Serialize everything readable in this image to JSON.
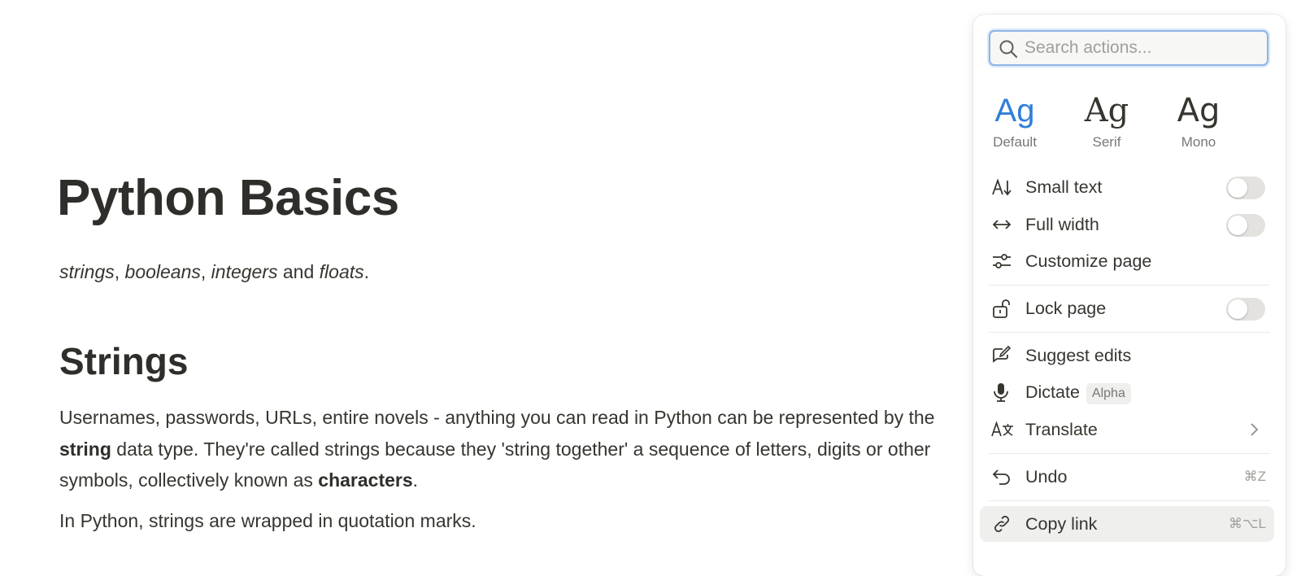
{
  "document": {
    "title": "Python Basics",
    "subtitle": {
      "items": [
        "strings",
        "booleans",
        "integers",
        "floats"
      ],
      "sep1": ", ",
      "sep2": ", ",
      "conj": " and ",
      "end": "."
    },
    "heading": "Strings",
    "paragraph1": {
      "part1": "Usernames, passwords, URLs, entire novels - anything you can read in Python can be represented by the ",
      "bold1": "string",
      "part2": " data type. They're called strings because they 'string together' a sequence of letters, digits or other symbols, collectively known as ",
      "bold2": "characters",
      "part3": "."
    },
    "paragraph2": "In Python, strings are wrapped in quotation marks."
  },
  "menu": {
    "search_placeholder": "Search actions...",
    "font_options": [
      {
        "glyph": "Ag",
        "label": "Default",
        "selected": true
      },
      {
        "glyph": "Ag",
        "label": "Serif",
        "selected": false
      },
      {
        "glyph": "Ag",
        "label": "Mono",
        "selected": false
      }
    ],
    "items": {
      "small_text": {
        "label": "Small text",
        "icon": "small-text-icon",
        "toggle": false
      },
      "full_width": {
        "label": "Full width",
        "icon": "full-width-icon",
        "toggle": false
      },
      "customize_page": {
        "label": "Customize page",
        "icon": "sliders-icon"
      },
      "lock_page": {
        "label": "Lock page",
        "icon": "lock-icon",
        "toggle": false
      },
      "suggest_edits": {
        "label": "Suggest edits",
        "icon": "suggest-edit-icon"
      },
      "dictate": {
        "label": "Dictate",
        "badge": "Alpha",
        "icon": "microphone-icon"
      },
      "translate": {
        "label": "Translate",
        "icon": "translate-icon"
      },
      "undo": {
        "label": "Undo",
        "shortcut": "⌘Z",
        "icon": "undo-icon"
      },
      "copy_link": {
        "label": "Copy link",
        "shortcut": "⌘⌥L",
        "icon": "link-icon"
      }
    }
  },
  "colors": {
    "accent": "#2f7fd8",
    "text": "#37352f",
    "muted": "#787774",
    "hover": "#efefed"
  }
}
